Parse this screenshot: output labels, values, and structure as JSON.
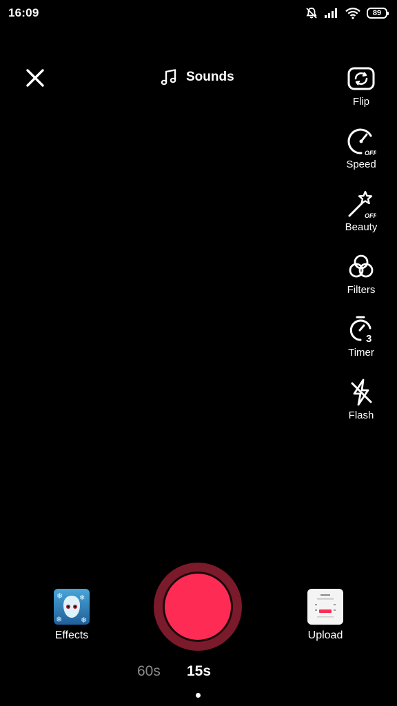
{
  "status_bar": {
    "time": "16:09",
    "battery": "89",
    "icons": [
      "bell-off-icon",
      "signal-icon",
      "wifi-icon",
      "battery-icon"
    ]
  },
  "top": {
    "close_icon": "close-icon",
    "sounds_label": "Sounds",
    "sounds_icon": "music-note-icon"
  },
  "tools": [
    {
      "label": "Flip",
      "icon": "flip-camera-icon"
    },
    {
      "label": "Speed",
      "icon": "speed-icon",
      "badge": "OFF"
    },
    {
      "label": "Beauty",
      "icon": "beauty-wand-icon",
      "badge": "OFF"
    },
    {
      "label": "Filters",
      "icon": "filters-icon"
    },
    {
      "label": "Timer",
      "icon": "timer-icon",
      "badge": "3"
    },
    {
      "label": "Flash",
      "icon": "flash-off-icon"
    }
  ],
  "bottom": {
    "effects_label": "Effects",
    "upload_label": "Upload"
  },
  "durations": {
    "option_60": "60s",
    "option_15": "15s",
    "selected": "15s"
  },
  "colors": {
    "record": "#fe2c55",
    "record_ring": "#7a1a2b",
    "background": "#000000"
  }
}
